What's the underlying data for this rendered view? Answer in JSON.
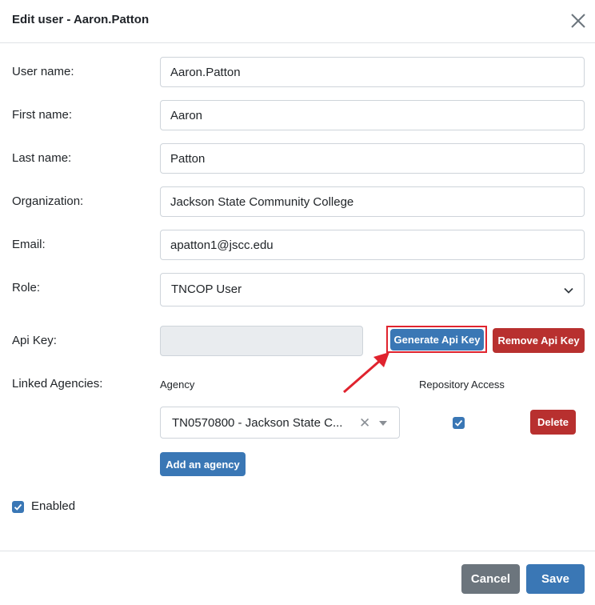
{
  "dialog": {
    "title": "Edit user - Aaron.Patton",
    "close_icon": "close-icon"
  },
  "form": {
    "username": {
      "label": "User name:",
      "value": "Aaron.Patton"
    },
    "first_name": {
      "label": "First name:",
      "value": "Aaron"
    },
    "last_name": {
      "label": "Last name:",
      "value": "Patton"
    },
    "organization": {
      "label": "Organization:",
      "value": "Jackson State Community College"
    },
    "email": {
      "label": "Email:",
      "value": "apatton1@jscc.edu"
    },
    "role": {
      "label": "Role:",
      "value": "TNCOP User",
      "icon": "chevron-down-icon"
    },
    "api_key": {
      "label": "Api Key:",
      "value": "",
      "generate_label": "Generate Api Key",
      "remove_label": "Remove Api Key"
    }
  },
  "linked_agencies": {
    "label": "Linked Agencies:",
    "col_agency": "Agency",
    "col_repo": "Repository Access",
    "rows": [
      {
        "agency": "TN0570800 - Jackson State C...",
        "repository_access": true,
        "delete_label": "Delete"
      }
    ],
    "add_label": "Add an agency"
  },
  "enabled": {
    "label": "Enabled",
    "checked": true
  },
  "footer": {
    "cancel_label": "Cancel",
    "save_label": "Save"
  },
  "colors": {
    "primary": "#3a77b5",
    "danger": "#b8302f",
    "secondary": "#6c757d",
    "highlight": "#e0232e"
  }
}
